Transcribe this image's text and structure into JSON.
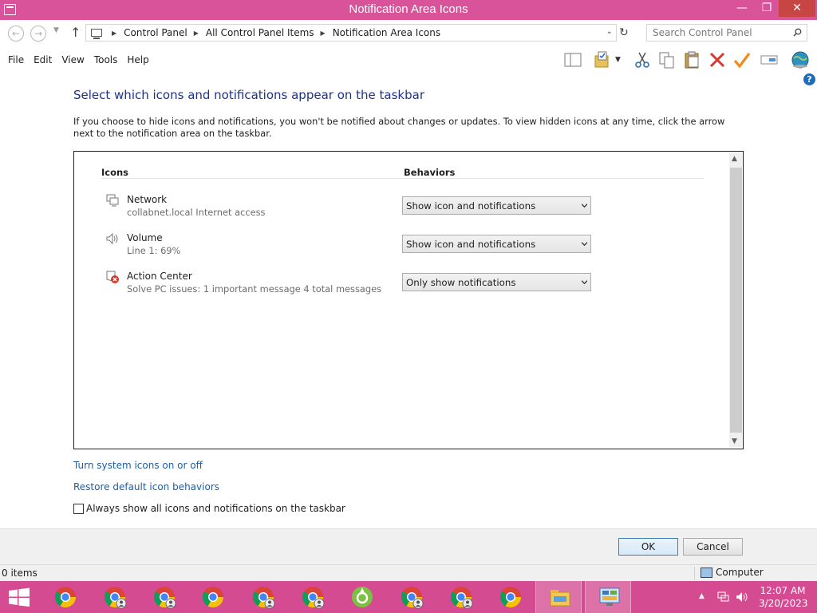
{
  "window": {
    "title": "Notification Area Icons",
    "min_glyph": "—",
    "max_glyph": "❐",
    "close_glyph": "✕"
  },
  "address": {
    "breadcrumbs": [
      "Control Panel",
      "All Control Panel Items",
      "Notification Area Icons"
    ],
    "search_placeholder": "Search Control Panel"
  },
  "menu": [
    "File",
    "Edit",
    "View",
    "Tools",
    "Help"
  ],
  "toolbar_icons": [
    "layout-icon",
    "properties-folder-icon",
    "cut-icon",
    "copy-icon",
    "paste-icon",
    "delete-icon",
    "check-icon",
    "rename-icon",
    "globe-icon"
  ],
  "main": {
    "heading": "Select which icons and notifications appear on the taskbar",
    "description": "If you choose to hide icons and notifications, you won't be notified about changes or updates. To view hidden icons at any time, click the arrow next to the notification area on the taskbar.",
    "col_icons": "Icons",
    "col_behaviors": "Behaviors",
    "rows": [
      {
        "name": "Network",
        "sub": "collabnet.local Internet access",
        "behavior": "Show icon and notifications",
        "icon": "network-icon"
      },
      {
        "name": "Volume",
        "sub": "Line 1: 69%",
        "behavior": "Show icon and notifications",
        "icon": "volume-icon"
      },
      {
        "name": "Action Center",
        "sub": "Solve PC issues: 1 important message  4 total messages",
        "behavior": "Only show notifications",
        "icon": "action-center-icon"
      }
    ],
    "link_system_icons": "Turn system icons on or off",
    "link_restore": "Restore default icon behaviors",
    "always_show_label": "Always show all icons and notifications on the taskbar",
    "always_show_checked": false
  },
  "buttons": {
    "ok": "OK",
    "cancel": "Cancel"
  },
  "status": {
    "items": "0 items",
    "location": "Computer"
  },
  "taskbar": {
    "apps": [
      "chrome",
      "chrome-profile",
      "chrome-profile",
      "chrome",
      "chrome-profile",
      "chrome-profile",
      "app-green",
      "chrome-profile",
      "chrome-profile",
      "chrome",
      "file-explorer",
      "control-panel"
    ],
    "time": "12:07 AM",
    "date": "3/20/2023"
  },
  "colors": {
    "titlebar": "#d9539a",
    "taskbar": "#d44b91",
    "heading": "#1e3287",
    "link": "#1a5fab"
  }
}
